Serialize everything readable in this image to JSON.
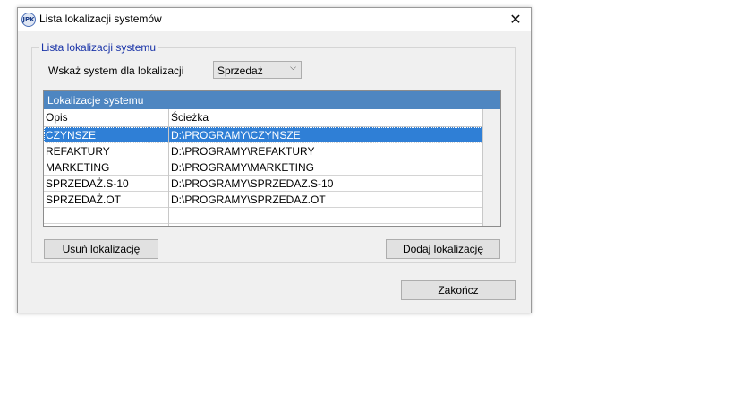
{
  "window": {
    "title": "Lista lokalizacji systemów",
    "icon_label": "JPK",
    "close_glyph": "✕"
  },
  "group": {
    "legend": "Lista lokalizacji systemu",
    "system_label": "Wskaż system dla lokalizacji",
    "system_value": "Sprzedaż",
    "arrow_glyph": "⌵"
  },
  "table": {
    "title": "Lokalizacje systemu",
    "columns": [
      "Opis",
      "Ścieżka"
    ],
    "rows": [
      [
        "CZYNSZE",
        "D:\\PROGRAMY\\CZYNSZE"
      ],
      [
        "REFAKTURY",
        "D:\\PROGRAMY\\REFAKTURY"
      ],
      [
        "MARKETING",
        "D:\\PROGRAMY\\MARKETING"
      ],
      [
        "SPRZEDAŻ.S-10",
        "D:\\PROGRAMY\\SPRZEDAZ.S-10"
      ],
      [
        "SPRZEDAŻ.OT",
        "D:\\PROGRAMY\\SPRZEDAZ.OT"
      ],
      [
        "",
        ""
      ]
    ],
    "selected_row": 0
  },
  "buttons": {
    "remove": "Usuń lokalizację",
    "add": "Dodaj lokalizację",
    "finish": "Zakończ"
  },
  "colors": {
    "header_blue": "#4e86c1",
    "selection_blue": "#2f7fd6",
    "legend_text": "#1a34a8"
  }
}
